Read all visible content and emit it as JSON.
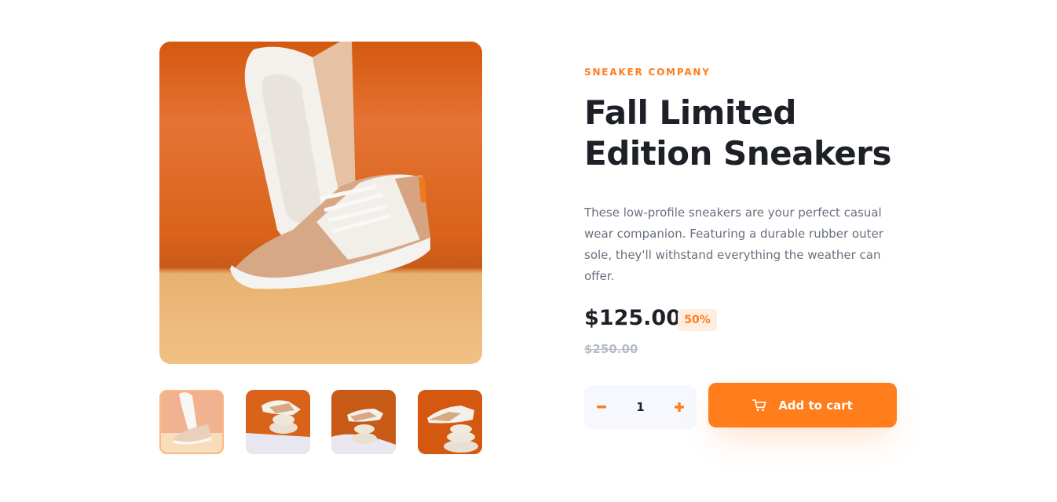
{
  "product": {
    "company": "SNEAKER COMPANY",
    "title": "Fall Limited Edition Sneakers",
    "description": "These low-profile sneakers are your perfect casual wear companion. Featuring a durable rubber outer sole, they'll withstand everything the weather can offer.",
    "price": "$125.00",
    "discount": "50%",
    "original_price": "$250.00"
  },
  "gallery": {
    "active_index": 0,
    "thumbnail_count": 4
  },
  "cart": {
    "quantity": "1",
    "add_label": "Add to cart",
    "icons": {
      "minus": "minus-icon",
      "plus": "plus-icon",
      "cart": "cart-icon"
    }
  },
  "colors": {
    "accent": "#ff7d1a",
    "accent_pale": "#ffede0",
    "heading": "#1d2026",
    "body_text": "#68707d",
    "muted": "#b6bcc8",
    "qty_bg": "#f6f8fd"
  }
}
